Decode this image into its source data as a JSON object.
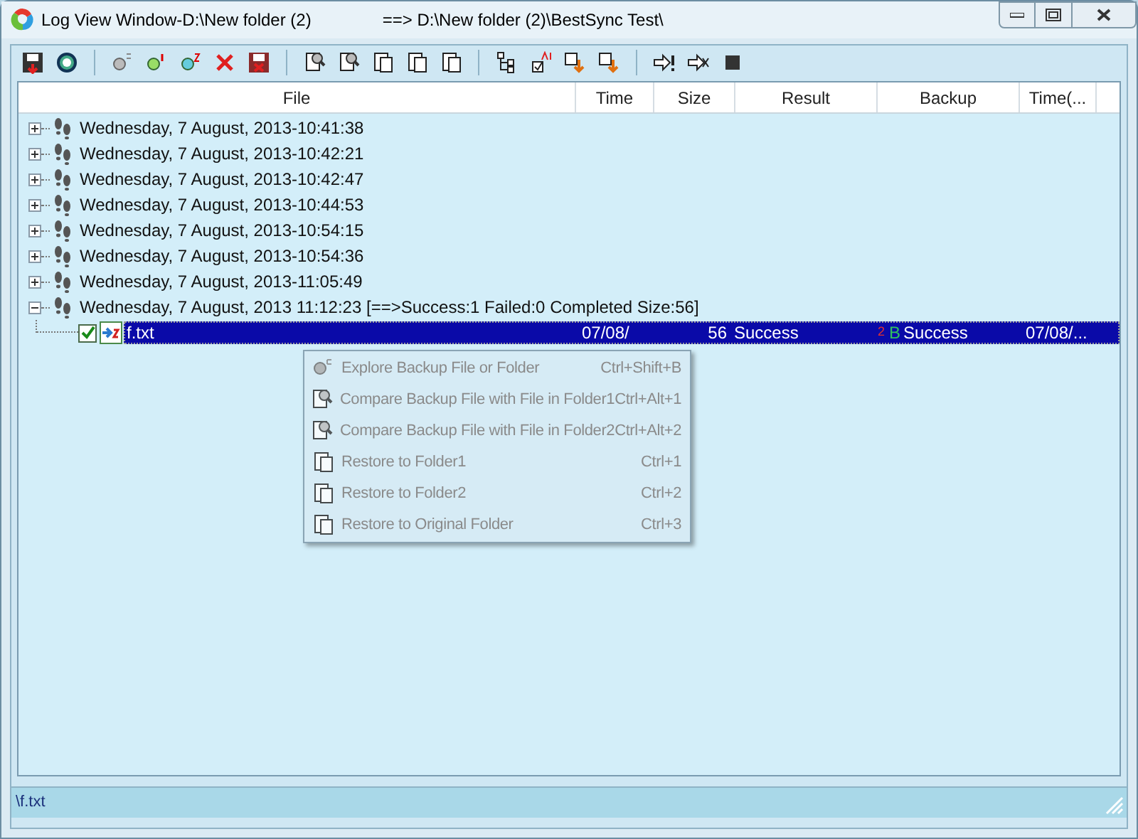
{
  "window": {
    "title": "Log View Window-D:\\New folder (2)",
    "title_target": "==> D:\\New folder (2)\\BestSync Test\\"
  },
  "table": {
    "columns": [
      "File",
      "Time",
      "Size",
      "Result",
      "Backup",
      "Time(..."
    ],
    "rows": [
      {
        "label": "Wednesday, 7 August, 2013-10:41:38",
        "expanded": false
      },
      {
        "label": "Wednesday, 7 August, 2013-10:42:21",
        "expanded": false
      },
      {
        "label": "Wednesday, 7 August, 2013-10:42:47",
        "expanded": false
      },
      {
        "label": "Wednesday, 7 August, 2013-10:44:53",
        "expanded": false
      },
      {
        "label": "Wednesday, 7 August, 2013-10:54:15",
        "expanded": false
      },
      {
        "label": "Wednesday, 7 August, 2013-10:54:36",
        "expanded": false
      },
      {
        "label": "Wednesday, 7 August, 2013-11:05:49",
        "expanded": false
      },
      {
        "label": "Wednesday, 7 August, 2013 11:12:23 [==>Success:1 Failed:0 Completed Size:56]",
        "expanded": true,
        "children": [
          {
            "file": "f.txt",
            "checked": true,
            "selected": true,
            "time": "07/08/",
            "size": "56",
            "result": "Success",
            "backup_folder": "2",
            "backup_mark": "B",
            "backup": "Success",
            "time_2": "07/08/..."
          }
        ]
      }
    ]
  },
  "context_menu": [
    {
      "label": "Explore Backup File or Folder",
      "shortcut": "Ctrl+Shift+B",
      "disabled": true
    },
    {
      "label": "Compare Backup File with File in Folder1",
      "shortcut": "Ctrl+Alt+1",
      "disabled": true
    },
    {
      "label": "Compare Backup File with File in Folder2",
      "shortcut": "Ctrl+Alt+2",
      "disabled": true
    },
    {
      "label": "Restore to Folder1",
      "shortcut": "Ctrl+1",
      "disabled": true
    },
    {
      "label": "Restore to Folder2",
      "shortcut": "Ctrl+2",
      "disabled": true
    },
    {
      "label": "Restore to Original Folder",
      "shortcut": "Ctrl+3",
      "disabled": true
    }
  ],
  "status_bar": "\\f.txt"
}
